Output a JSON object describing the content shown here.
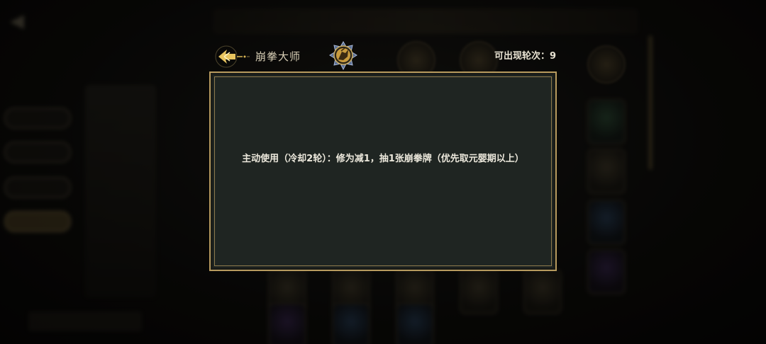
{
  "header": {
    "back_icon": "golden-arrow-back-icon",
    "title": "崩拳大师",
    "emblem_icon": "fist-master-emblem-icon",
    "rounds_label": "可出现轮次：",
    "rounds_value": "9"
  },
  "dialog": {
    "description": "主动使用（冷却2轮）：修为减1，抽1张崩拳牌（优先取元婴期以上）"
  },
  "colors": {
    "frame_gold": "#b79a5e",
    "dialog_bg": "#1f2522",
    "text": "#ece8dc"
  }
}
